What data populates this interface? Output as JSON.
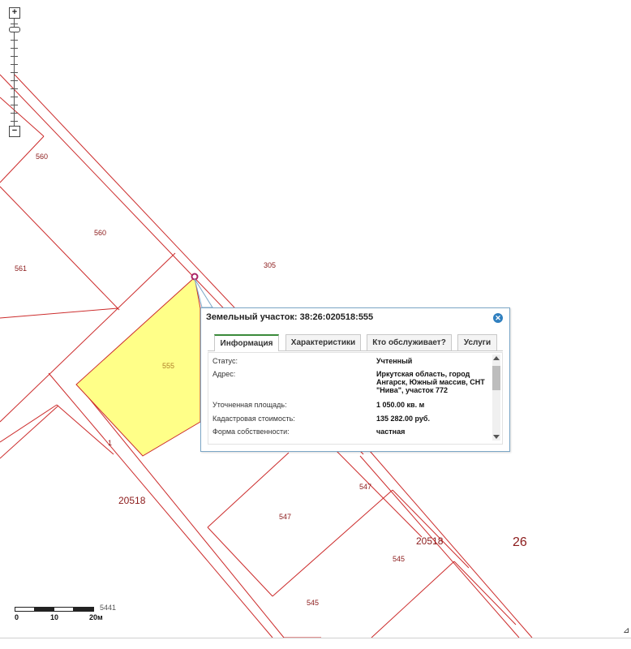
{
  "map": {
    "plot_labels": {
      "p560a": "560",
      "p560b": "560",
      "p561": "561",
      "p305": "305",
      "p555": "555",
      "p1": "1",
      "p547a": "547",
      "p547b": "547",
      "p545a": "545",
      "p545b": "545",
      "q20518a": "20518",
      "q20518b": "20518",
      "d26": "26"
    },
    "colors": {
      "boundary": "#cc2b2b",
      "selected_fill": "#ffff88",
      "label": "#8b1a1a"
    }
  },
  "zoom": {
    "plus": "+",
    "minus": "−"
  },
  "scale": {
    "t0": "0",
    "t10": "10",
    "t20": "20м",
    "extra": "5441"
  },
  "popup": {
    "title": "Земельный участок: 38:26:020518:555",
    "close_icon": "close-icon",
    "tabs": [
      "Информация",
      "Характеристики",
      "Кто обслуживает?",
      "Услуги"
    ],
    "rows": [
      {
        "key": "Статус:",
        "value": "Учтенный"
      },
      {
        "key": "Адрес:",
        "value": "Иркутская область, город Ангарск, Южный массив, СНТ \"Нива\", участок 772"
      },
      {
        "key": "Уточненная площадь:",
        "value": "1 050.00 кв. м"
      },
      {
        "key": "Кадастровая стоимость:",
        "value": "135 282.00 руб."
      },
      {
        "key": "Форма собственности:",
        "value": "частная"
      }
    ]
  }
}
